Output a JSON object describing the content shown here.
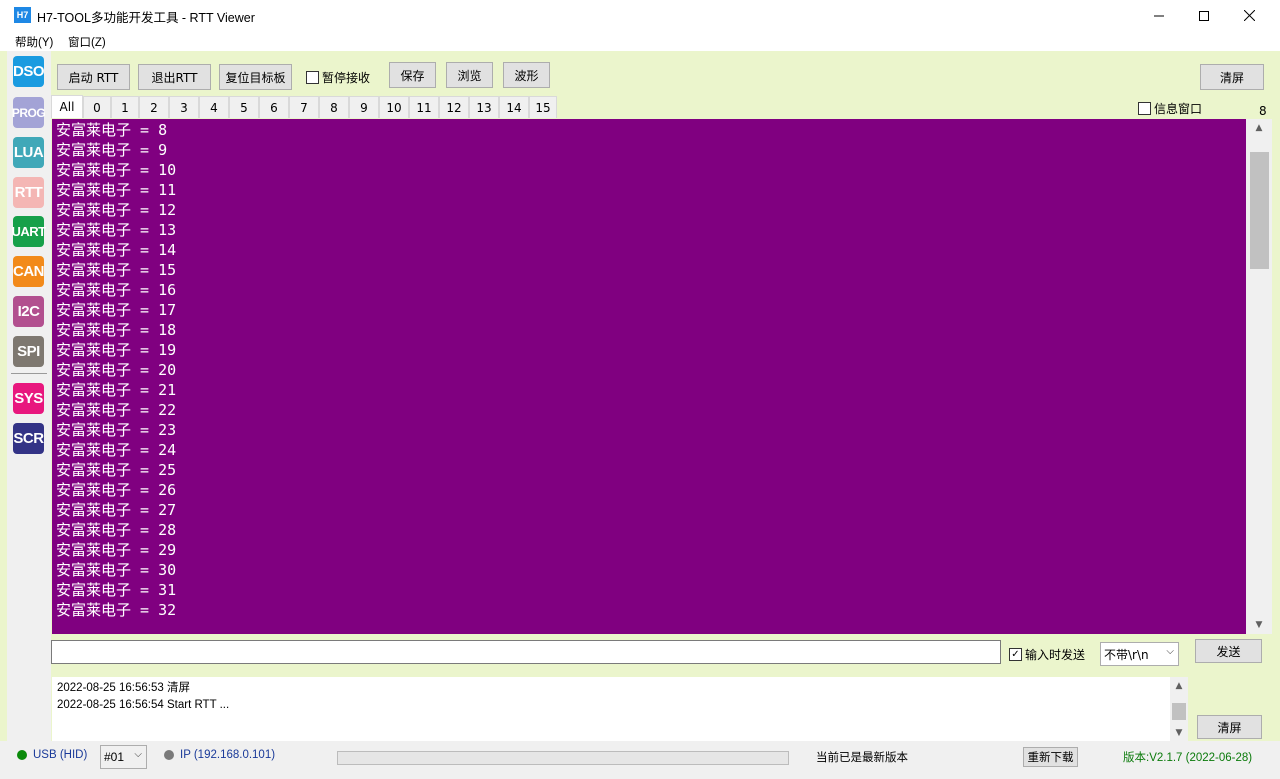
{
  "window": {
    "logo": "H7",
    "title": "H7-TOOL多功能开发工具 - RTT Viewer",
    "minimize": "—",
    "maximize": "☐",
    "close": "✕"
  },
  "menu": [
    {
      "label": "帮助(Y)"
    },
    {
      "label": "窗口(Z)"
    }
  ],
  "sidebar": [
    {
      "label": "DSO",
      "color": "#1a9be0"
    },
    {
      "label": "PROG",
      "color": "#a3a3d6"
    },
    {
      "label": "LUA",
      "color": "#40a8b8"
    },
    {
      "label": "RTT",
      "color": "#f4b6b4"
    },
    {
      "label": "UART",
      "color": "#16a04a"
    },
    {
      "label": "CAN",
      "color": "#f28a1a"
    },
    {
      "label": "I2C",
      "color": "#b2508f"
    },
    {
      "label": "SPI",
      "color": "#7e7870"
    },
    {
      "label": "SYS",
      "color": "#e8177e"
    },
    {
      "label": "SCR",
      "color": "#333386"
    }
  ],
  "toolbar": {
    "start_rtt": "启动 RTT",
    "exit_rtt": "退出RTT",
    "reset_target": "复位目标板",
    "pause_receive": "暂停接收",
    "save": "保存",
    "browse": "浏览",
    "waveform": "波形",
    "clear": "清屏"
  },
  "tabs": [
    "All",
    "0",
    "1",
    "2",
    "3",
    "4",
    "5",
    "6",
    "7",
    "8",
    "9",
    "10",
    "11",
    "12",
    "13",
    "14",
    "15"
  ],
  "info_window": {
    "label": "信息窗口",
    "count": "8"
  },
  "terminal_lines": [
    "安富莱电子 = 8",
    "安富莱电子 = 9",
    "安富莱电子 = 10",
    "安富莱电子 = 11",
    "安富莱电子 = 12",
    "安富莱电子 = 13",
    "安富莱电子 = 14",
    "安富莱电子 = 15",
    "安富莱电子 = 16",
    "安富莱电子 = 17",
    "安富莱电子 = 18",
    "安富莱电子 = 19",
    "安富莱电子 = 20",
    "安富莱电子 = 21",
    "安富莱电子 = 22",
    "安富莱电子 = 23",
    "安富莱电子 = 24",
    "安富莱电子 = 25",
    "安富莱电子 = 26",
    "安富莱电子 = 27",
    "安富莱电子 = 28",
    "安富莱电子 = 29",
    "安富莱电子 = 30",
    "安富莱电子 = 31",
    "安富莱电子 = 32"
  ],
  "send_row": {
    "input_value": "",
    "send_on_input": "输入时发送",
    "line_ending": "不带\\r\\n",
    "send": "发送"
  },
  "log": {
    "lines": [
      "2022-08-25 16:56:53 清屏",
      "2022-08-25 16:56:54 Start RTT ..."
    ],
    "clear": "清屏"
  },
  "status": {
    "usb": "USB (HID)",
    "device": "#01",
    "ip": "IP (192.168.0.101)",
    "update_msg": "当前已是最新版本",
    "redownload": "重新下载",
    "version": "版本:V2.1.7 (2022-06-28)"
  }
}
